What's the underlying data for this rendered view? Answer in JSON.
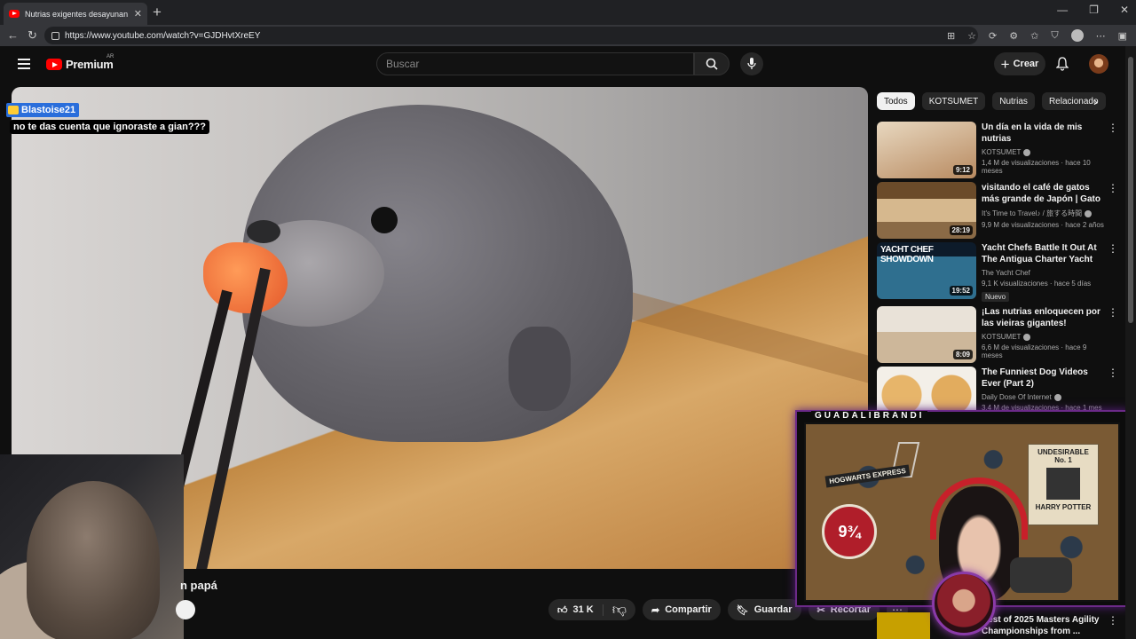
{
  "browser": {
    "tab_title": "Nutrias exigentes desayunan con p",
    "url": "https://www.youtube.com/watch?v=GJDHvtXreEY"
  },
  "youtube": {
    "logo_text": "Premium",
    "country": "AR",
    "search_placeholder": "Buscar",
    "create_label": "Crear"
  },
  "video": {
    "chat_user": "Blastoise21",
    "chat_message": "no te das cuenta que ignoraste a gian???",
    "title_fragment": "n papá",
    "likes": "31 K",
    "share_label": "Compartir",
    "save_label": "Guardar",
    "clip_label": "Recortar"
  },
  "chips": [
    "Todos",
    "KOTSUMET",
    "Nutrias",
    "Relacionado"
  ],
  "recommendations": [
    {
      "title": "Un día en la vida de mis nutrias",
      "channel": "KOTSUMET",
      "meta": "1,4 M de visualizaciones · hace 10 meses",
      "duration": "9:12",
      "badge": "",
      "thumb_color": "#c9a27a"
    },
    {
      "title": "visitando el café de gatos más grande de Japón | Gato Café ...",
      "channel": "It's Time to Travel♪ / 旅する時間",
      "meta": "9,9 M de visualizaciones · hace 2 años",
      "duration": "28:19",
      "badge": "",
      "thumb_color": "#b7864e"
    },
    {
      "title": "Yacht Chefs Battle It Out At The Antigua Charter Yacht Show | ...",
      "channel": "The Yacht Chef",
      "meta": "9,1 K visualizaciones · hace 5 días",
      "duration": "19:52",
      "badge": "Nuevo",
      "thumb_color": "#2b5a78",
      "thumb_text": "YACHT CHEF SHOWDOWN"
    },
    {
      "title": "¡Las nutrias enloquecen por las vieiras gigantes!",
      "channel": "KOTSUMET",
      "meta": "6,6 M de visualizaciones · hace 9 meses",
      "duration": "8:09",
      "badge": "",
      "thumb_color": "#d8c6ae"
    },
    {
      "title": "The Funniest Dog Videos Ever (Part 2)",
      "channel": "Daily Dose Of Internet",
      "meta": "3,4 M de visualizaciones · hace 1 mes",
      "duration": "",
      "badge": "",
      "thumb_color": "#d1a05a"
    }
  ],
  "last_rec_title": "Best of 2025 Masters Agility Championships from ...",
  "streamer_name": "GUADALIBRANDI",
  "room": {
    "hogwarts": "HOGWARTS EXPRESS",
    "platform": "9¾",
    "poster_top": "UNDESIRABLE",
    "poster_no": "No. 1",
    "poster_name": "HARRY POTTER"
  }
}
